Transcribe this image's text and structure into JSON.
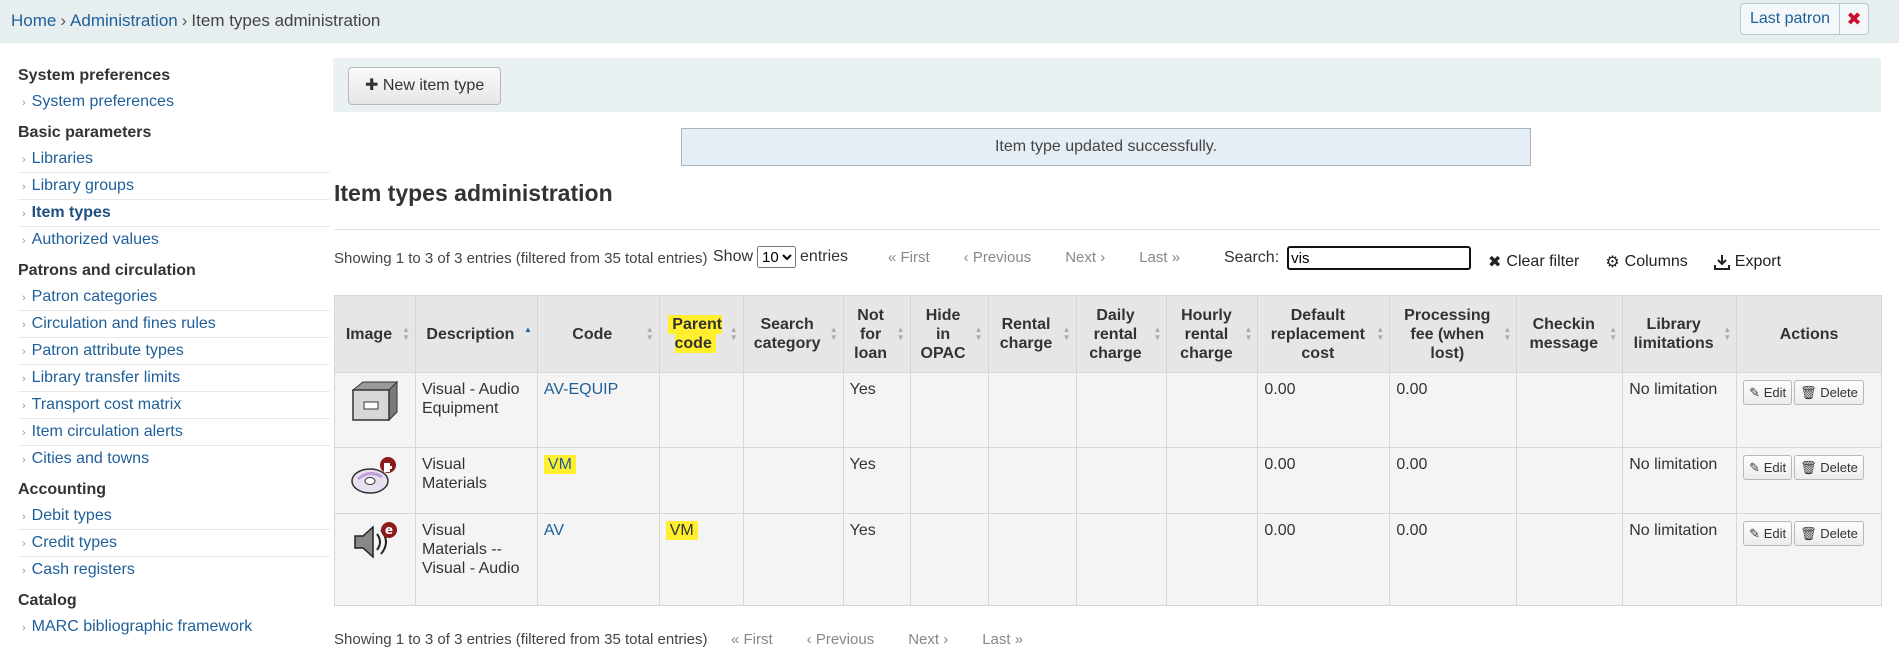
{
  "breadcrumb": {
    "home": "Home",
    "admin": "Administration",
    "current": "Item types administration",
    "sep": "›"
  },
  "last_patron": {
    "label": "Last patron",
    "close": "✖"
  },
  "sidebar": [
    {
      "heading": "System preferences",
      "items": [
        "System preferences"
      ]
    },
    {
      "heading": "Basic parameters",
      "items": [
        "Libraries",
        "Library groups",
        "Item types",
        "Authorized values"
      ]
    },
    {
      "heading": "Patrons and circulation",
      "items": [
        "Patron categories",
        "Circulation and fines rules",
        "Patron attribute types",
        "Library transfer limits",
        "Transport cost matrix",
        "Item circulation alerts",
        "Cities and towns"
      ]
    },
    {
      "heading": "Accounting",
      "items": [
        "Debit types",
        "Credit types",
        "Cash registers"
      ]
    },
    {
      "heading": "Catalog",
      "items": [
        "MARC bibliographic framework"
      ]
    }
  ],
  "current_item": "Item types",
  "toolbar": {
    "new_label": "New item type"
  },
  "alert": "Item type updated successfully.",
  "title": "Item types administration",
  "info_text": "Showing 1 to 3 of 3 entries (filtered from 35 total entries)",
  "show": {
    "label": "Show",
    "value": "10",
    "suffix": "entries"
  },
  "pager": {
    "first": "« First",
    "previous": "‹ Previous",
    "next": "Next ›",
    "last": "Last »"
  },
  "search": {
    "label": "Search:",
    "value": "vis"
  },
  "tools": {
    "clear": "Clear filter",
    "columns": "Columns",
    "export": "Export"
  },
  "columns": [
    "Image",
    "Description",
    "Code",
    "Parent code",
    "Search category",
    "Not for loan",
    "Hide in OPAC",
    "Rental charge",
    "Daily rental charge",
    "Hourly rental charge",
    "Default replacement cost",
    "Processing fee (when lost)",
    "Checkin message",
    "Library limitations",
    "Actions"
  ],
  "rows": [
    {
      "image": "cabinet-icon",
      "description": "Visual - Audio Equipment",
      "code": "AV-EQUIP",
      "parent": "",
      "not_for_loan": "Yes",
      "replacement": "0.00",
      "processing": "0.00",
      "limitations": "No limitation"
    },
    {
      "image": "cd-icon",
      "description": "Visual Materials",
      "code": "VM",
      "parent": "",
      "not_for_loan": "Yes",
      "replacement": "0.00",
      "processing": "0.00",
      "limitations": "No limitation"
    },
    {
      "image": "speaker-icon",
      "description": "Visual Materials -- Visual - Audio",
      "code": "AV",
      "parent": "VM",
      "not_for_loan": "Yes",
      "replacement": "0.00",
      "processing": "0.00",
      "limitations": "No limitation"
    }
  ],
  "actions": {
    "edit": "Edit",
    "delete": "Delete"
  }
}
